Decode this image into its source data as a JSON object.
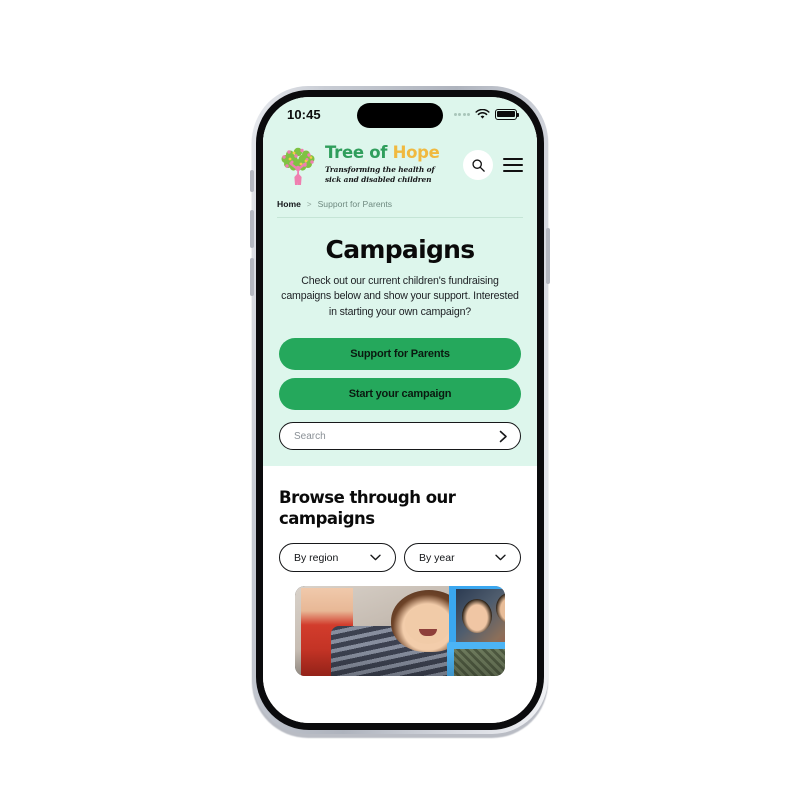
{
  "status_bar": {
    "time": "10:45",
    "wifi_icon": "wifi-icon",
    "battery_icon": "battery-icon",
    "signal_icon": "signal-dots-icon"
  },
  "header": {
    "logo_icon": "tree-of-hope-logo-icon",
    "brand_first": "Tree of ",
    "brand_second": "Hope",
    "tagline_line1": "Transforming the health of",
    "tagline_line2": "sick and disabled children",
    "search_icon": "search-icon",
    "menu_icon": "hamburger-menu-icon"
  },
  "breadcrumb": {
    "home": "Home",
    "separator": ">",
    "current": "Support for Parents"
  },
  "hero": {
    "title": "Campaigns",
    "description": "Check out our current children's fundraising campaigns below and show your support. Interested in starting your own campaign?"
  },
  "actions": {
    "support_button": "Support for Parents",
    "campaign_button": "Start your campaign",
    "search_placeholder": "Search",
    "search_value": "",
    "search_submit_icon": "chevron-right-icon"
  },
  "browse": {
    "title": "Browse through our campaigns",
    "filters": [
      {
        "label": "By region",
        "icon": "chevron-down-icon"
      },
      {
        "label": "By year",
        "icon": "chevron-down-icon"
      }
    ],
    "collage_alt": "campaign-photo-collage"
  },
  "colors": {
    "mint_background": "#DDF6EC",
    "brand_green": "#2F9E5C",
    "brand_yellow": "#F0B93F",
    "button_green": "#25A85C",
    "text_dark": "#0A0A0A",
    "frame_blue": "#3AA7F0"
  }
}
